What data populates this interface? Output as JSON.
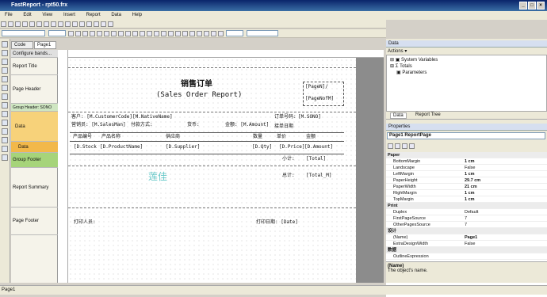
{
  "window": {
    "title": "FastReport - rpt50.frx"
  },
  "menu": [
    "File",
    "Edit",
    "View",
    "Insert",
    "Report",
    "Data",
    "Help"
  ],
  "tabs": {
    "code": "Code",
    "page1": "Page1"
  },
  "configure_bands": "Configure bands...",
  "bands": [
    {
      "label": "Report Title"
    },
    {
      "label": "Page Header"
    },
    {
      "label": "Group Header: SONO"
    },
    {
      "label": "Data"
    },
    {
      "label": "Data"
    },
    {
      "label": "Group Footer"
    },
    {
      "label": "Report Summary"
    },
    {
      "label": "Page Footer"
    }
  ],
  "report": {
    "title_cn": "销售订单",
    "title_en": "(Sales Order Report)",
    "page_n": "[PageN]/",
    "page_nof": "[PageNofM]",
    "customer": "客户: [M.CustomerCode][M.NativeName]",
    "order_no_label": "订单号码:",
    "order_no": "[M.SONO]",
    "salesman": "营销员: [M.SalesMan]",
    "pay": "付款方式:",
    "currency": "货币:",
    "amount_lbl": "金额: [M.Amount]",
    "deliver": "接单日期",
    "col_code": "产品编号",
    "col_name": "产品名称",
    "col_supplier": "供应商",
    "col_qty": "数量",
    "col_price": "单价",
    "col_amount": "金额",
    "d_stock": "[D.Stock",
    "d_product": "[D.ProductName]",
    "d_supplier": "[D.Supplier]",
    "d_qty": "[D.Qty]",
    "d_price": "[D.Price]",
    "d_amount": "[D.Amount]",
    "subtotal": "小计:",
    "total": "[Total]",
    "grand_lbl": "总计:",
    "grand": "[Total_M]",
    "signature": "莲佳",
    "printed_by": "打印人员:",
    "print_date": "打印日期: [Date]"
  },
  "data_panel": {
    "title": "Data",
    "actions": "Actions",
    "tree": [
      "System Variables",
      "Totals",
      "Parameters"
    ],
    "tabs": [
      "Data",
      "Report Tree"
    ]
  },
  "properties": {
    "title": "Properties",
    "object": "Page1 ReportPage",
    "rows": [
      {
        "k": "Paper",
        "v": "",
        "cat": true
      },
      {
        "k": "BottomMargin",
        "v": "1 cm"
      },
      {
        "k": "Landscape",
        "v": "False"
      },
      {
        "k": "LeftMargin",
        "v": "1 cm"
      },
      {
        "k": "PaperHeight",
        "v": "29.7 cm"
      },
      {
        "k": "PaperWidth",
        "v": "21 cm"
      },
      {
        "k": "RightMargin",
        "v": "1 cm"
      },
      {
        "k": "TopMargin",
        "v": "1 cm"
      },
      {
        "k": "Print",
        "v": "",
        "cat": true
      },
      {
        "k": "Duplex",
        "v": "Default"
      },
      {
        "k": "FirstPageSource",
        "v": "7"
      },
      {
        "k": "OtherPagesSource",
        "v": "7"
      },
      {
        "k": "设计",
        "v": "",
        "cat": true
      },
      {
        "k": "(Name)",
        "v": "Page1"
      },
      {
        "k": "ExtraDesignWidth",
        "v": "False"
      },
      {
        "k": "数据",
        "v": "",
        "cat": true
      },
      {
        "k": "OutlineExpression",
        "v": ""
      }
    ],
    "desc_title": "(Name)",
    "desc_text": "The object's name."
  },
  "status": "Page1"
}
